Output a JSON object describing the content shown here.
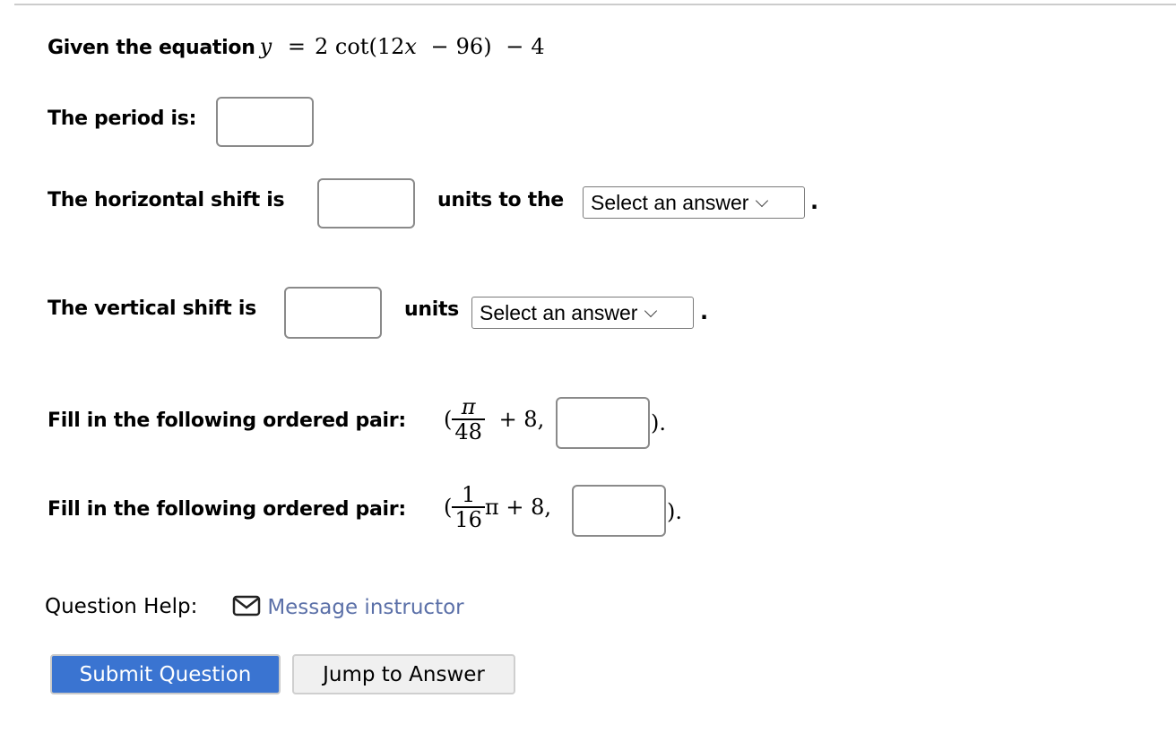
{
  "question": {
    "intro_label": "Given the equation",
    "equation": {
      "lhs": "y",
      "eq": "=",
      "coef": "2",
      "func": "cot",
      "open": "(",
      "inner_coef": "12",
      "inner_var": "x",
      "minus1": "−",
      "inner_const": "96",
      "close": ")",
      "minus2": "−",
      "const": "4"
    }
  },
  "period": {
    "label": "The period is:",
    "value": ""
  },
  "horizontal_shift": {
    "label": "The horizontal shift is",
    "value": "",
    "units_label": "units to the",
    "select_value": "Select an answer",
    "end": "."
  },
  "vertical_shift": {
    "label": "The vertical shift is",
    "value": "",
    "units_label": "units",
    "select_value": "Select an answer",
    "end": "."
  },
  "ordered_pairs": [
    {
      "label": "Fill in the following ordered pair:",
      "open": "(",
      "numerator": "π",
      "denominator": "48",
      "after": "+ 8,",
      "value": "",
      "close": ")."
    },
    {
      "label": "Fill in the following ordered pair:",
      "open": "(",
      "numerator": "1",
      "denominator": "16",
      "after": "π + 8,",
      "value": "",
      "close": ")."
    }
  ],
  "help": {
    "label": "Question Help:",
    "icon": "envelope-icon",
    "link_text": "Message instructor"
  },
  "buttons": {
    "submit": "Submit Question",
    "jump": "Jump to Answer"
  },
  "colors": {
    "primary": "#3a74d1",
    "link": "#5b70a8"
  }
}
